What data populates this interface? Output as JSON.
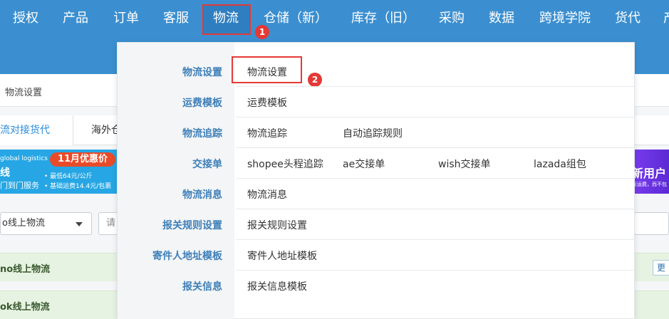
{
  "nav": {
    "items": [
      "授权",
      "产品",
      "订单",
      "客服",
      "物流",
      "仓储（新）",
      "库存（旧）",
      "采购",
      "数据",
      "跨境学院",
      "货代",
      "产"
    ],
    "active": "物流"
  },
  "steps": {
    "one": "1",
    "two": "2"
  },
  "page": {
    "breadcrumb": "物流设置",
    "tabs": [
      "流对接货代",
      "海外仓"
    ],
    "filter_select": "o线上物流",
    "filter_input_placeholder": "请",
    "groups": [
      "no线上物流",
      "ok线上物流"
    ],
    "more_button": "更多"
  },
  "banner": {
    "global_text": "global logistics",
    "tag": "11月优惠价",
    "line1": "线",
    "line2": "门到门服务",
    "price1": "• 最低64元/公斤",
    "price2": "• 基础运费14.4元/包裹"
  },
  "banner_right": {
    "title": "新用户",
    "sub": "际运费，而不包"
  },
  "menu": {
    "categories": [
      "物流设置",
      "运费模板",
      "物流追踪",
      "交接单",
      "物流消息",
      "报关规则设置",
      "寄件人地址模板",
      "报关信息"
    ],
    "rows": [
      [
        "物流设置"
      ],
      [
        "运费模板"
      ],
      [
        "物流追踪",
        "自动追踪规则"
      ],
      [
        "shopee头程追踪",
        "ae交接单",
        "wish交接单",
        "lazada组包"
      ],
      [
        "物流消息"
      ],
      [
        "报关规则设置"
      ],
      [
        "寄件人地址模板"
      ],
      [
        "报关信息模板"
      ]
    ]
  },
  "colors": {
    "header_blue": "#3b8fd0",
    "highlight_red": "#e53935",
    "category_blue": "#3e7fb8",
    "group_green": "#e7f3e2"
  }
}
